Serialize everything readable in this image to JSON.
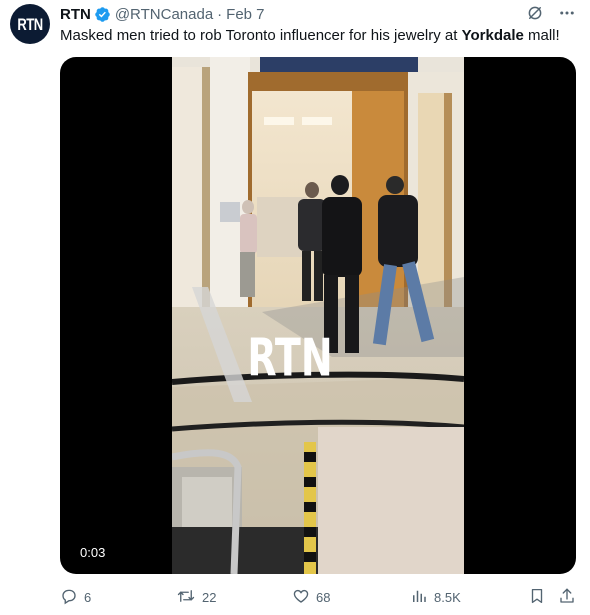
{
  "author": {
    "avatar_text": "RTN",
    "name": "RTN",
    "handle": "@RTNCanada",
    "separator": "·",
    "date": "Feb 7",
    "verified_color": "#1d9bf0"
  },
  "tweet": {
    "text_before": "Masked men tried to rob Toronto influencer for his jewelry at ",
    "text_bold": "Yorkdale",
    "text_after": " mall!"
  },
  "media": {
    "watermark": "RTN",
    "duration": "0:03"
  },
  "actions": {
    "reply_count": "6",
    "retweet_count": "22",
    "like_count": "68",
    "view_count": "8.5K"
  },
  "icons": [
    "grok-icon",
    "more-icon",
    "reply-icon",
    "retweet-icon",
    "like-icon",
    "views-icon",
    "bookmark-icon",
    "share-icon"
  ]
}
